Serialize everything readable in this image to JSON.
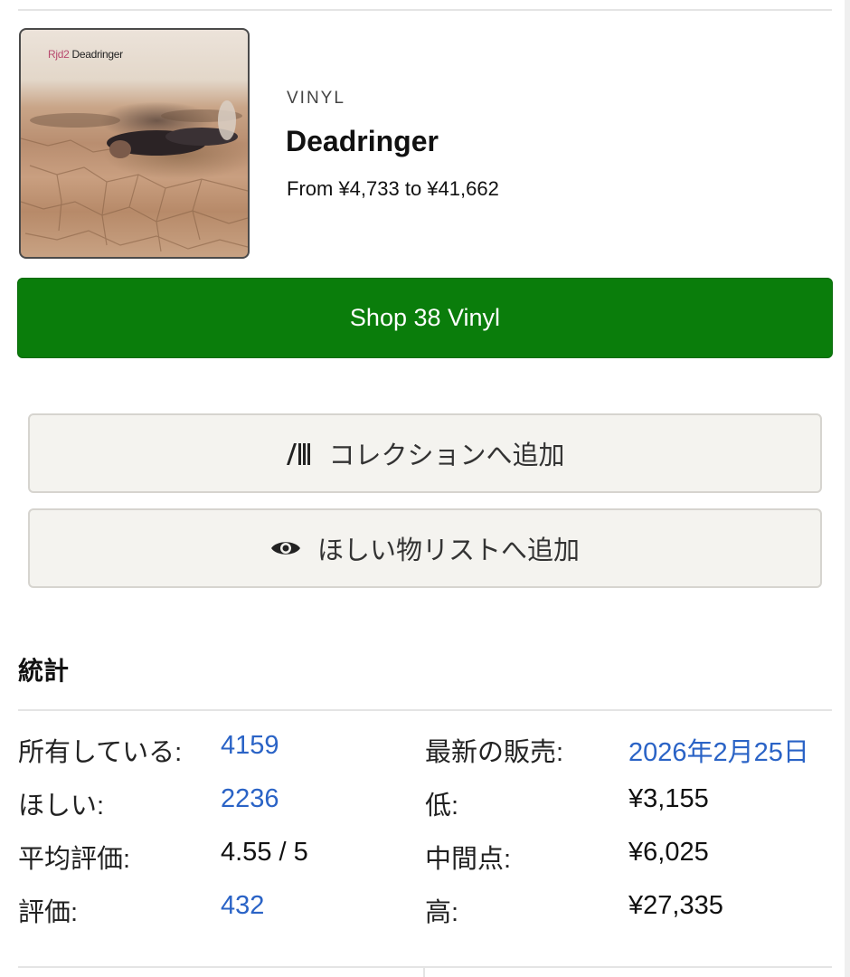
{
  "release": {
    "cover_artist_text": "Rjd2",
    "cover_title_text": "Deadringer",
    "format": "VINYL",
    "title": "Deadringer",
    "price_range": "From ¥4,733 to ¥41,662"
  },
  "actions": {
    "shop_label": "Shop 38 Vinyl",
    "collection_label": "コレクションへ追加",
    "collection_icon": "collection-icon",
    "wantlist_label": "ほしい物リストへ追加",
    "wantlist_icon": "eye-icon"
  },
  "stats": {
    "heading": "統計",
    "left": [
      {
        "label": "所有している:",
        "value": "4159",
        "link": true
      },
      {
        "label": "ほしい:",
        "value": "2236",
        "link": true
      },
      {
        "label": "平均評価:",
        "value": "4.55 / 5",
        "link": false
      },
      {
        "label": "評価:",
        "value": "432",
        "link": true
      }
    ],
    "right": [
      {
        "label": "最新の販売:",
        "value": "2026年2月25日",
        "link": true
      },
      {
        "label": "低:",
        "value": "¥3,155",
        "link": false
      },
      {
        "label": "中間点:",
        "value": "¥6,025",
        "link": false
      },
      {
        "label": "高:",
        "value": "¥27,335",
        "link": false
      }
    ]
  },
  "colors": {
    "shop_green": "#0a7d0b",
    "link_blue": "#2a63c6",
    "button_bg": "#f4f3ef"
  }
}
